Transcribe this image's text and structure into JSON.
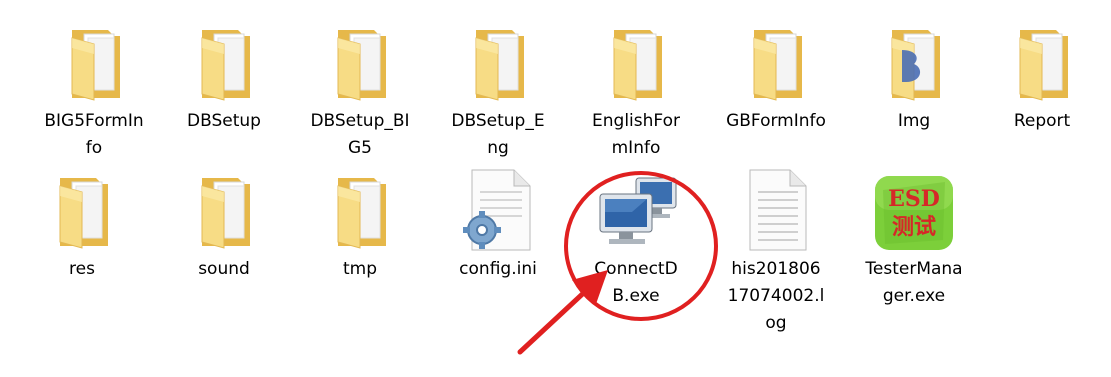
{
  "files": [
    {
      "label": "BIG5FormInfo",
      "icon": "folder-icon"
    },
    {
      "label": "DBSetup",
      "icon": "folder-icon"
    },
    {
      "label": "DBSetup_BIG5",
      "icon": "folder-icon"
    },
    {
      "label": "DBSetup_Eng",
      "icon": "folder-icon"
    },
    {
      "label": "EnglishFormInfo",
      "icon": "folder-icon"
    },
    {
      "label": "GBFormInfo",
      "icon": "folder-icon"
    },
    {
      "label": "Img",
      "icon": "folder-icon"
    },
    {
      "label": "Report",
      "icon": "folder-icon"
    },
    {
      "label": "res",
      "icon": "folder-icon"
    },
    {
      "label": "sound",
      "icon": "folder-icon"
    },
    {
      "label": "tmp",
      "icon": "folder-icon"
    },
    {
      "label": "config.ini",
      "icon": "config-file-icon"
    },
    {
      "label": "ConnectDB.exe",
      "icon": "network-computers-icon"
    },
    {
      "label": "his20180617074002.log",
      "icon": "text-file-icon"
    },
    {
      "label": "TesterManager.exe",
      "icon": "esd-app-icon"
    }
  ],
  "app_icon_text": [
    "ESD",
    "测试"
  ],
  "colors": {
    "folder_back": "#e8b94a",
    "folder_front": "#f6dc8a",
    "annotation": "#e02020"
  }
}
